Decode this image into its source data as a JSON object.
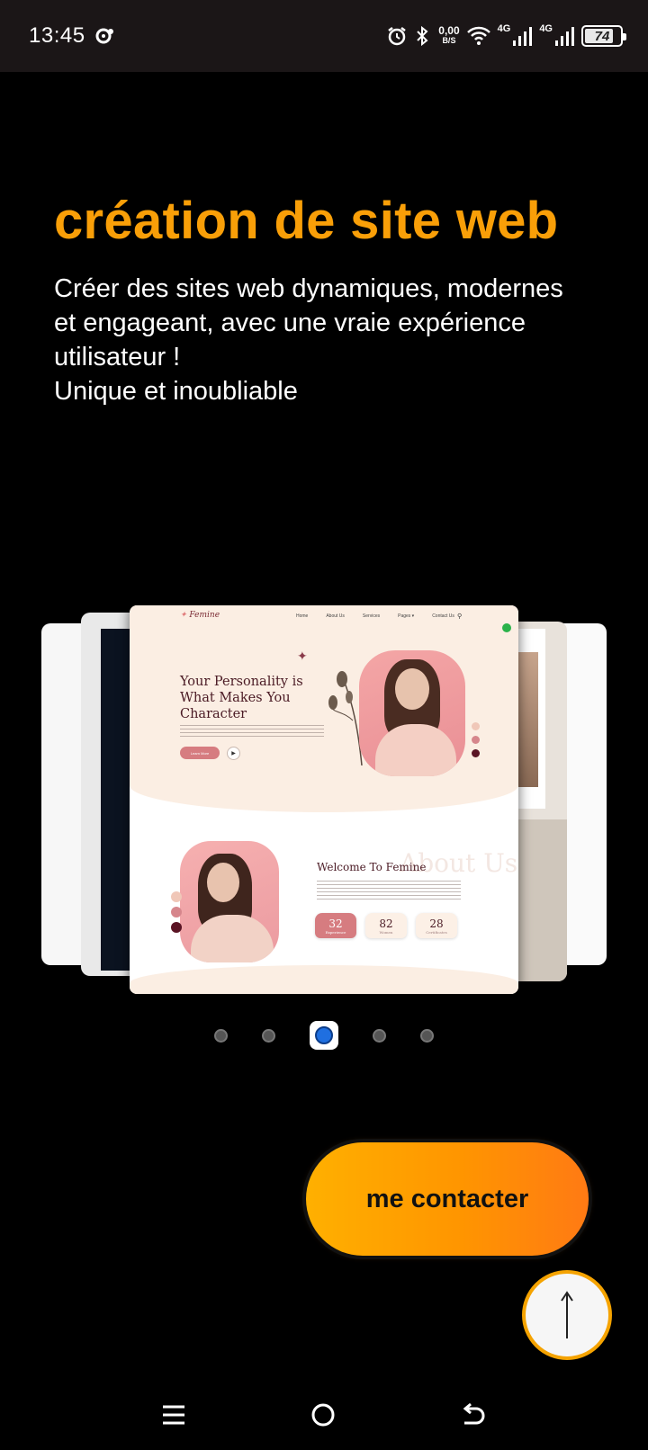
{
  "status_bar": {
    "time": "13:45",
    "net_speed_value": "0,00",
    "net_speed_unit": "B/S",
    "signal1_label": "4G",
    "signal2_label": "4G",
    "battery_level": "74",
    "battery_fraction": 0.74,
    "icons": [
      "notification-dot-icon",
      "alarm-icon",
      "bluetooth-icon",
      "wifi-icon",
      "signal-icon",
      "battery-icon"
    ]
  },
  "hero": {
    "title": "création de site web",
    "title_color": "#f99f08",
    "description_lines": [
      "Créer des sites web dynamiques, modernes",
      "et engageant, avec une vraie expérience",
      "utilisateur !",
      "Unique et inoubliable"
    ]
  },
  "carousel": {
    "active_index": 2,
    "slide_count": 5,
    "active_slide": {
      "logo": "Femine",
      "nav_links": [
        "Home",
        "About Us",
        "Services",
        "Pages ▾",
        "Contact Us"
      ],
      "heading": "Your Personality is What Makes You Character",
      "button_label": "Learn More",
      "welcome_title": "Welcome To Femine",
      "watermark": "About Us",
      "stats": [
        {
          "value": "32",
          "label": "Experience"
        },
        {
          "value": "82",
          "label": "Women"
        },
        {
          "value": "28",
          "label": "Certificates"
        }
      ]
    }
  },
  "actions": {
    "contact_label": "me contacter",
    "scroll_top_icon": "arrow-up-icon",
    "accent_gradient": [
      "#ffb000",
      "#ff7a14"
    ]
  },
  "nav_bar": {
    "icons": [
      "menu-icon",
      "home-icon",
      "back-icon"
    ]
  }
}
